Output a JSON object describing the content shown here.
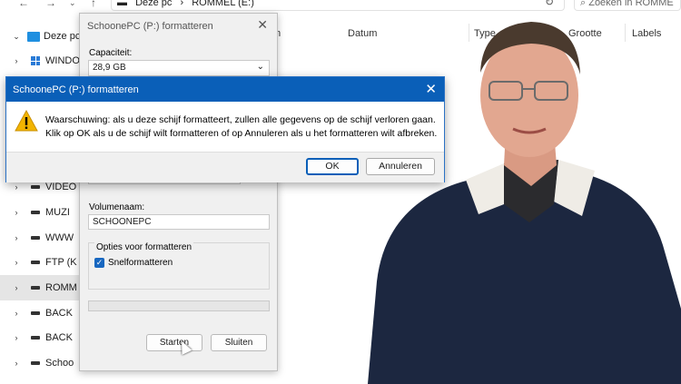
{
  "explorer": {
    "address_parts": [
      "Deze pc",
      "›",
      "ROMMEL (E:)"
    ],
    "search_placeholder": "Zoeken in ROMME",
    "columns": [
      "Datum",
      "Type",
      "Grootte",
      "Labels"
    ],
    "nav": [
      {
        "label": "Deze pc",
        "kind": "pc"
      },
      {
        "label": "WINDO",
        "kind": "win"
      },
      {
        "label": "VIDEO",
        "kind": "drive"
      },
      {
        "label": "MUZI",
        "kind": "drive"
      },
      {
        "label": "WWW",
        "kind": "drive"
      },
      {
        "label": "FTP (K",
        "kind": "drive"
      },
      {
        "label": "ROMM",
        "kind": "drive",
        "selected": true
      },
      {
        "label": "BACK",
        "kind": "drive"
      },
      {
        "label": "BACK",
        "kind": "drive"
      },
      {
        "label": "Schoo",
        "kind": "drive"
      }
    ]
  },
  "format_dialog": {
    "title": "SchoonePC (P:) formatteren",
    "capacity_label": "Capaciteit:",
    "capacity_value": "28,9 GB",
    "volume_label": "Volumenaam:",
    "volume_value": "SCHOONEPC",
    "options_label": "Opties voor formatteren",
    "quick_format_label": "Snelformatteren",
    "quick_format_checked": true,
    "start_label": "Starten",
    "close_label": "Sluiten"
  },
  "warning_dialog": {
    "title": "SchoonePC (P:) formatteren",
    "message_line1": "Waarschuwing: als u deze schijf formatteert, zullen alle gegevens op de schijf verloren gaan.",
    "message_line2": "Klik op OK als u de schijf wilt formatteren of op Annuleren als u het formatteren wilt afbreken.",
    "ok_label": "OK",
    "cancel_label": "Annuleren"
  },
  "colors": {
    "title_bar": "#0a5fb8",
    "accent": "#1867c0",
    "warning_icon": "#f2b400"
  }
}
